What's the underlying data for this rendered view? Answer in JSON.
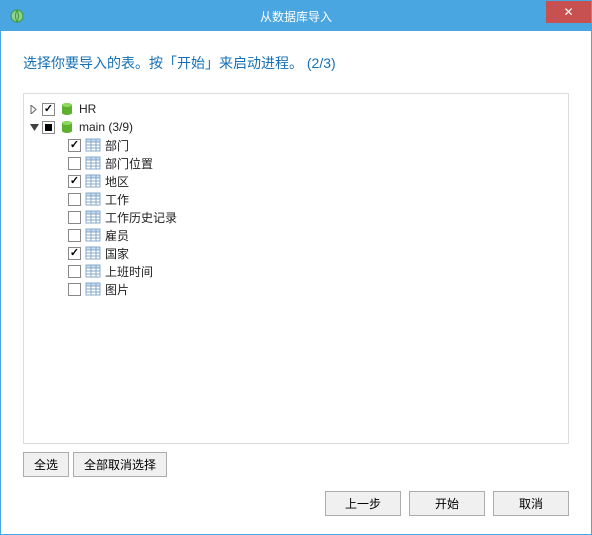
{
  "window": {
    "title": "从数据库导入"
  },
  "instruction": "选择你要导入的表。按「开始」来启动进程。 (2/3)",
  "tree": {
    "roots": [
      {
        "label": "HR",
        "state": "checked",
        "expanded": false
      },
      {
        "label": "main (3/9)",
        "state": "indeterminate",
        "expanded": true
      }
    ],
    "tables": [
      {
        "label": "部门",
        "checked": true
      },
      {
        "label": "部门位置",
        "checked": false
      },
      {
        "label": "地区",
        "checked": true
      },
      {
        "label": "工作",
        "checked": false
      },
      {
        "label": "工作历史记录",
        "checked": false
      },
      {
        "label": "雇员",
        "checked": false
      },
      {
        "label": "国家",
        "checked": true
      },
      {
        "label": "上班时间",
        "checked": false
      },
      {
        "label": "图片",
        "checked": false
      }
    ]
  },
  "buttons": {
    "select_all": "全选",
    "deselect_all": "全部取消选择",
    "back": "上一步",
    "start": "开始",
    "cancel": "取消"
  }
}
